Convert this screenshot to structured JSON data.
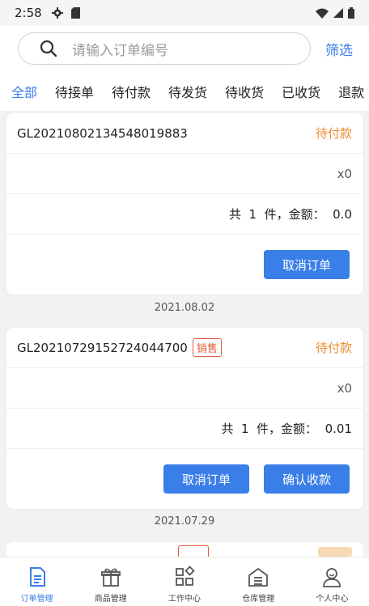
{
  "status_bar": {
    "time": "2:58"
  },
  "search": {
    "placeholder": "请输入订单编号",
    "filter_label": "筛选"
  },
  "tabs": [
    {
      "label": "全部",
      "active": true
    },
    {
      "label": "待接单",
      "active": false
    },
    {
      "label": "待付款",
      "active": false
    },
    {
      "label": "待发货",
      "active": false
    },
    {
      "label": "待收货",
      "active": false
    },
    {
      "label": "已收货",
      "active": false
    },
    {
      "label": "退款",
      "active": false
    }
  ],
  "orders": [
    {
      "order_no": "GL20210802134548019883",
      "tag": "",
      "status": "待付款",
      "quantity": "x0",
      "summary": "共  1  件，金额：  0.0",
      "buttons": [
        "取消订单"
      ],
      "date": "2021.08.02"
    },
    {
      "order_no": "GL20210729152724044700",
      "tag": "销售",
      "status": "待付款",
      "quantity": "x0",
      "summary": "共  1  件，金额：  0.01",
      "buttons": [
        "取消订单",
        "确认收款"
      ],
      "date": "2021.07.29"
    }
  ],
  "bottom_nav": [
    {
      "label": "订单管理",
      "icon": "order-doc-icon",
      "active": true
    },
    {
      "label": "商品管理",
      "icon": "gift-box-icon",
      "active": false
    },
    {
      "label": "工作中心",
      "icon": "grid-apps-icon",
      "active": false
    },
    {
      "label": "仓库管理",
      "icon": "warehouse-icon",
      "active": false
    },
    {
      "label": "个人中心",
      "icon": "person-icon",
      "active": false
    }
  ],
  "colors": {
    "accent": "#3a7ee8",
    "status_pending": "#ef8a2b",
    "tag": "#e35b3c"
  }
}
